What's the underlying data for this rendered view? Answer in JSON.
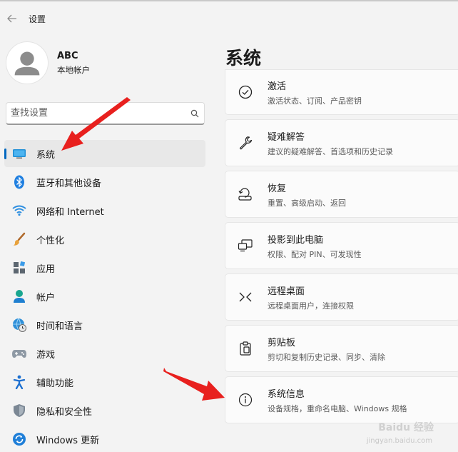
{
  "window": {
    "title": "设置"
  },
  "profile": {
    "name": "ABC",
    "account_type": "本地帐户"
  },
  "search": {
    "placeholder": "查找设置"
  },
  "sidebar": {
    "items": [
      {
        "label": "系统",
        "icon": "monitor-icon",
        "active": true
      },
      {
        "label": "蓝牙和其他设备",
        "icon": "bluetooth-icon"
      },
      {
        "label": "网络和 Internet",
        "icon": "wifi-icon"
      },
      {
        "label": "个性化",
        "icon": "paintbrush-icon"
      },
      {
        "label": "应用",
        "icon": "apps-icon"
      },
      {
        "label": "帐户",
        "icon": "person-icon"
      },
      {
        "label": "时间和语言",
        "icon": "globe-clock-icon"
      },
      {
        "label": "游戏",
        "icon": "gamepad-icon"
      },
      {
        "label": "辅助功能",
        "icon": "accessibility-icon"
      },
      {
        "label": "隐私和安全性",
        "icon": "shield-icon"
      },
      {
        "label": "Windows 更新",
        "icon": "windows-update-icon"
      }
    ]
  },
  "main": {
    "title": "系统",
    "cards": [
      {
        "title": "激活",
        "subtitle": "激活状态、订阅、产品密钥",
        "icon": "check-circle-icon"
      },
      {
        "title": "疑难解答",
        "subtitle": "建议的疑难解答、首选项和历史记录",
        "icon": "wrench-icon"
      },
      {
        "title": "恢复",
        "subtitle": "重置、高级启动、返回",
        "icon": "recovery-icon"
      },
      {
        "title": "投影到此电脑",
        "subtitle": "权限、配对 PIN、可发现性",
        "icon": "project-icon"
      },
      {
        "title": "远程桌面",
        "subtitle": "远程桌面用户，连接权限",
        "icon": "remote-desktop-icon"
      },
      {
        "title": "剪贴板",
        "subtitle": "剪切和复制历史记录、同步、清除",
        "icon": "clipboard-icon"
      },
      {
        "title": "系统信息",
        "subtitle": "设备规格，重命名电脑、Windows 规格",
        "icon": "info-icon"
      }
    ]
  },
  "watermark": {
    "text": "Baidu 经验",
    "url": "jingyan.baidu.com"
  },
  "colors": {
    "accent": "#0067c0",
    "arrow": "#e8201e",
    "background": "#f3f3f3"
  }
}
